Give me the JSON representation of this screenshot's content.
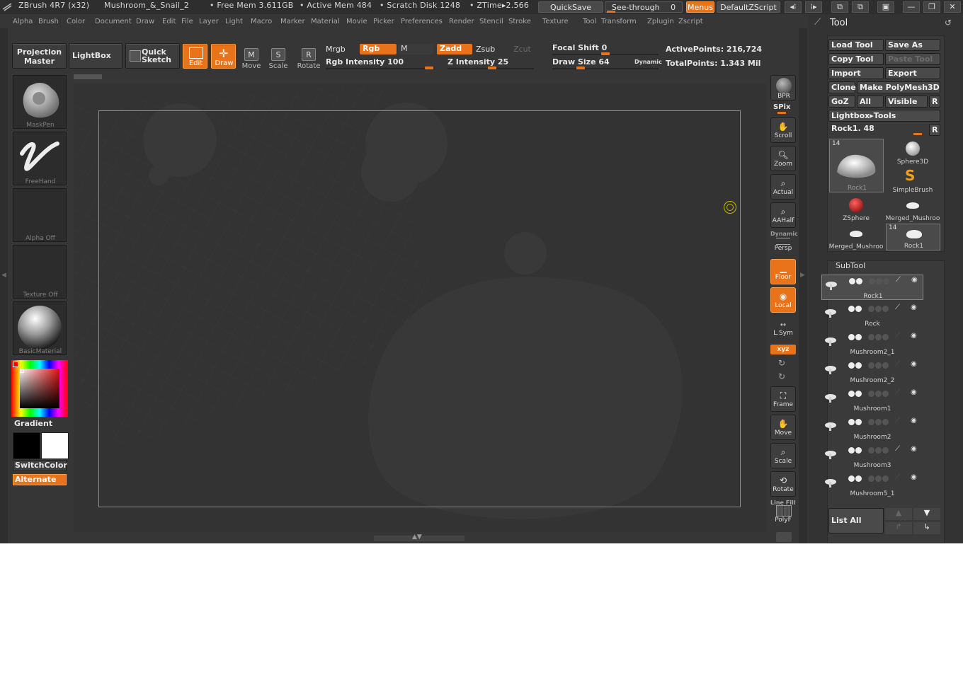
{
  "titlebar": {
    "app": "ZBrush 4R7 (x32)",
    "document": "Mushroom_&_Snail_2",
    "free_mem": "• Free Mem 3.611GB",
    "active_mem": "• Active Mem 484",
    "scratch": "• Scratch Disk 1248",
    "ztime": "• ZTime▸2.566",
    "quicksave": "QuickSave",
    "see_through": "See-through",
    "see_through_value": "0",
    "menus": "Menus",
    "zscript": "DefaultZScript",
    "min_icon": "—",
    "max_icon": "❐",
    "close_icon": "✕"
  },
  "menubar": [
    "Alpha",
    "Brush",
    "Color",
    "Document",
    "Draw",
    "Edit",
    "File",
    "Layer",
    "Light",
    "Macro",
    "Marker",
    "Material",
    "Movie",
    "Picker",
    "Preferences",
    "Render",
    "Stencil",
    "Stroke",
    "Texture",
    "Tool",
    "Transform",
    "Zplugin",
    "Zscript"
  ],
  "shelf": {
    "projection_master": [
      "Projection",
      "Master"
    ],
    "lightbox": "LightBox",
    "quick_sketch": [
      "Quick",
      "Sketch"
    ],
    "edit": "Edit",
    "draw": "Draw",
    "move": "Move",
    "scale": "Scale",
    "rotate": "Rotate",
    "mrgb": "Mrgb",
    "rgb": "Rgb",
    "m": "M",
    "rgb_intensity": "Rgb  Intensity 100",
    "zadd": "Zadd",
    "zsub": "Zsub",
    "zcut": "Zcut",
    "z_intensity": "Z  Intensity 25",
    "focal_shift": "Focal Shift 0",
    "draw_size": "Draw  Size 64",
    "dynamic": "Dynamic",
    "active_points": "ActivePoints: 216,724",
    "total_points": "TotalPoints: 1.343  Mil"
  },
  "left": {
    "brush": "MaskPen",
    "stroke": "FreeHand",
    "alpha": "Alpha  Off",
    "texture": "Texture  Off",
    "material": "BasicMaterial",
    "gradient": "Gradient",
    "switch_color": "SwitchColor",
    "alternate": "Alternate",
    "primary_color": "#000000",
    "secondary_color": "#ffffff"
  },
  "right_shelf": {
    "bpr": "BPR",
    "spix": "SPix",
    "scroll": "Scroll",
    "zoom": "Zoom",
    "actual": "Actual",
    "aahalf": "AAHalf",
    "dynamic": "Dynamic",
    "persp": "Persp",
    "floor": "Floor",
    "local": "Local",
    "lsym": "L.Sym",
    "xyz": "xyz",
    "frame": "Frame",
    "move": "Move",
    "scale": "Scale",
    "rotate": "Rotate",
    "linefill": "Line Fill",
    "polyf": "PolyF"
  },
  "tool": {
    "title": "Tool",
    "load": "Load Tool",
    "save_as": "Save As",
    "copy": "Copy Tool",
    "paste": "Paste Tool",
    "import": "Import",
    "export": "Export",
    "clone": "Clone",
    "make_polymesh": "Make PolyMesh3D",
    "goz": "GoZ",
    "all": "All",
    "visible": "Visible",
    "r": "R",
    "lightbox_tools": "Lightbox▸Tools",
    "current_tool": "Rock1. 48",
    "r2": "R",
    "cells": [
      {
        "label": "Rock1",
        "badge": "14"
      },
      {
        "label": "Sphere3D",
        "badge": ""
      },
      {
        "label": "SimpleBrush",
        "badge": ""
      },
      {
        "label": "ZSphere",
        "badge": ""
      },
      {
        "label": "Merged_Mushroo",
        "badge": ""
      },
      {
        "label": "Merged_Mushroo",
        "badge": ""
      },
      {
        "label": "Rock1",
        "badge": "14"
      }
    ]
  },
  "subtool": {
    "title": "SubTool",
    "items": [
      "Rock1",
      "Rock",
      "Mushroom2_1",
      "Mushroom2_2",
      "Mushroom1",
      "Mushroom2",
      "Mushroom3",
      "Mushroom5_1"
    ],
    "list_all": "List  All"
  }
}
